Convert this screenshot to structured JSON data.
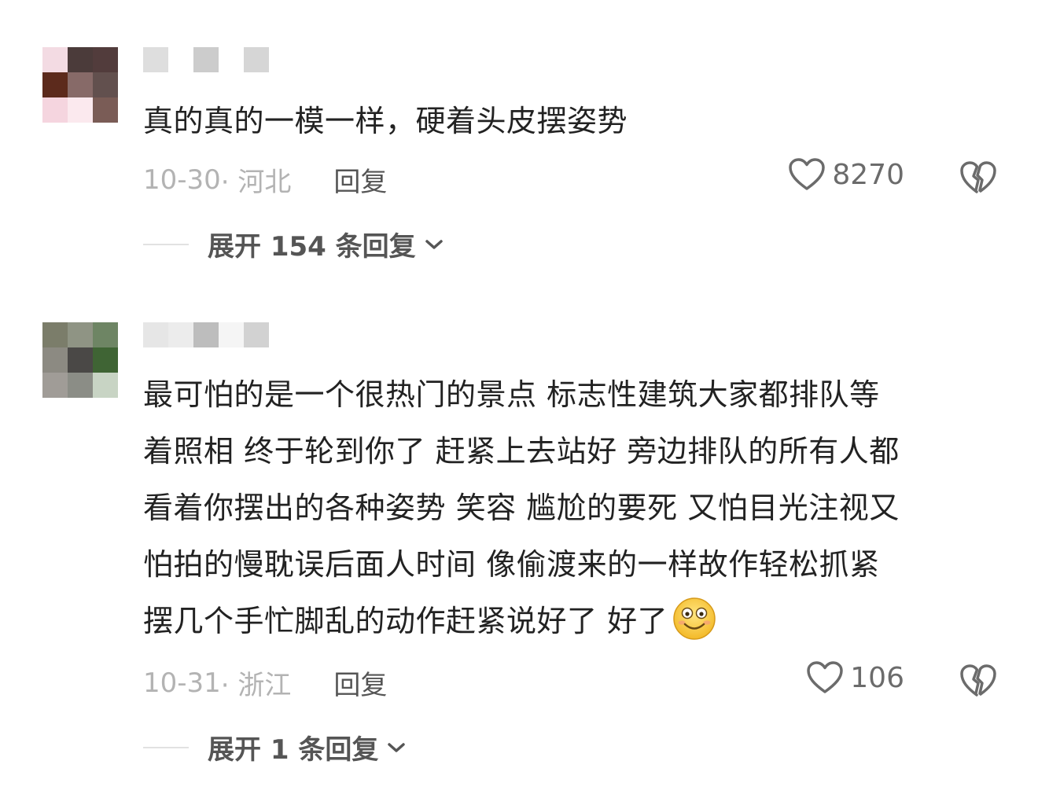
{
  "comments": [
    {
      "text": "真的真的一模一样，硬着头皮摆姿势",
      "date": "10-30",
      "location": "· 河北",
      "reply_label": "回复",
      "likes": "8270",
      "expand_label": "展开 154 条回复",
      "avatar_colors": [
        "#f3dbe3",
        "#4b3b3a",
        "#523c3c",
        "#5c2a1c",
        "#876a68",
        "#62504e",
        "#f5d5df",
        "#fbe9ee",
        "#7a5c56"
      ],
      "name_colors": [
        "#dedede",
        "#ffffff",
        "#cccccc",
        "#ffffff",
        "#d6d6d6"
      ]
    },
    {
      "text_lines": [
        "最可怕的是一个很热门的景点  标志性建筑大家都排队等",
        "着照相 终于轮到你了 赶紧上去站好 旁边排队的所有人都",
        "看着你摆出的各种姿势 笑容 尴尬的要死 又怕目光注视又",
        "怕拍的慢耽误后面人时间 像偷渡来的一样故作轻松抓紧",
        "摆几个手忙脚乱的动作赶紧说好了 好了"
      ],
      "date": "10-31",
      "location": "· 浙江",
      "reply_label": "回复",
      "likes": "106",
      "expand_label": "展开 1 条回复",
      "emoji": "smile-emoji",
      "avatar_colors": [
        "#7b7d6a",
        "#8f9484",
        "#6e8564",
        "#8c8a82",
        "#4a4846",
        "#3f6434",
        "#a09c97",
        "#8b8d86",
        "#c8d4c4"
      ],
      "name_colors": [
        "#e6e6e6",
        "#ececec",
        "#bdbdbd",
        "#f5f5f5",
        "#d2d2d2"
      ]
    }
  ],
  "colors": {
    "text": "#222222",
    "meta": "#b3b3b3",
    "secondary": "#555555",
    "icon": "#6b6b6b"
  }
}
